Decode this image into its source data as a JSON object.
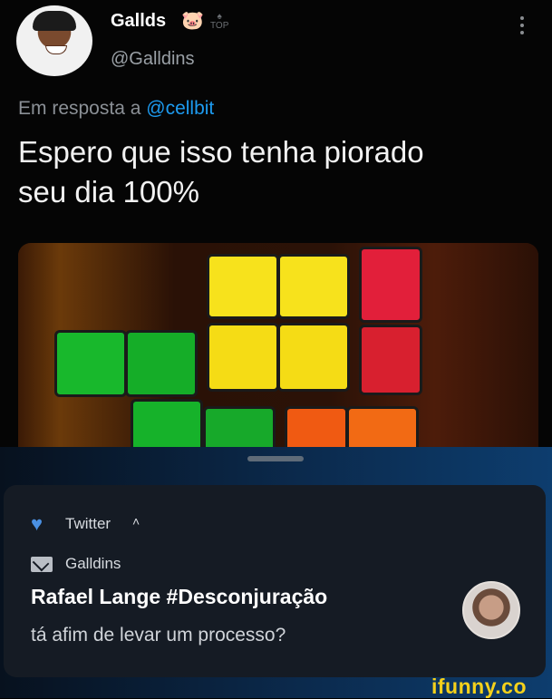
{
  "tweet": {
    "author_name": "Gallds",
    "author_handle": "@Galldins",
    "badge_emoji": "🐷",
    "badge_label": "TOP",
    "reply_prefix": "Em resposta a",
    "reply_mention": "@cellbit",
    "text_line1": "Espero que isso tenha piorado",
    "text_line2": "seu dia 100%",
    "media_description_icon": "tetris-lamp-image"
  },
  "notification": {
    "app_name": "Twitter",
    "sender": "Galldins",
    "title": "Rafael Lange #Desconjuração",
    "text": "tá afim de levar um processo?"
  },
  "watermark": {
    "text": "ifunny.co"
  },
  "colors": {
    "background": "#000000",
    "mention_blue": "#1d9bf0",
    "ifunny_yellow": "#f5d11b",
    "tetris_yellow": "#ffe11a",
    "tetris_green": "#15b82b",
    "tetris_red": "#e2223a",
    "tetris_orange": "#f05a12"
  }
}
